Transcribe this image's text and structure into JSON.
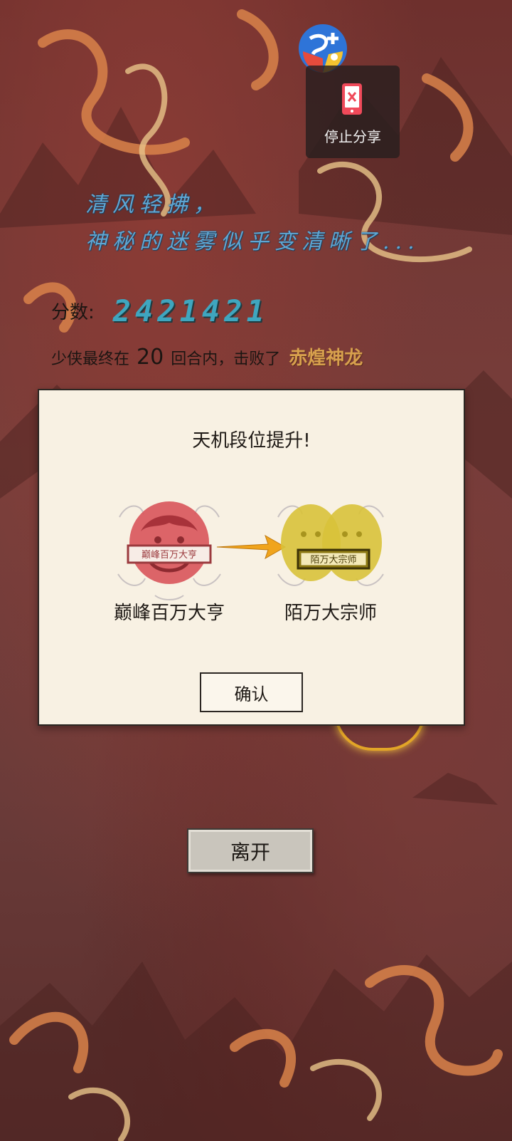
{
  "poem": {
    "line1": "清风轻拂，",
    "line2": "神秘的迷雾似乎变清晰了..."
  },
  "score": {
    "label": "分数:",
    "value": "2421421"
  },
  "result": {
    "prefix": "少侠最终在",
    "rounds": "20",
    "middle": "回合内，击败了",
    "boss": "赤煌神龙"
  },
  "dialog": {
    "title": "天机段位提升!",
    "from_rank": {
      "name": "巅峰百万大亨",
      "badge_text": "巅峰百万大亨",
      "color": "#d8545a"
    },
    "to_rank": {
      "name": "陌万大宗师",
      "badge_text": "陌万大宗师",
      "color": "#d8c23a"
    },
    "confirm_label": "确认"
  },
  "leave_label": "离开",
  "screen_share": {
    "stop_label": "停止分享",
    "icon": "phone-stop-icon"
  },
  "colors": {
    "background": "#6e302d",
    "dialog_bg": "#f8f1e3",
    "score_color": "#3fa6bf",
    "boss_color": "#d7a04d",
    "poem_color": "#5fa6d3"
  }
}
